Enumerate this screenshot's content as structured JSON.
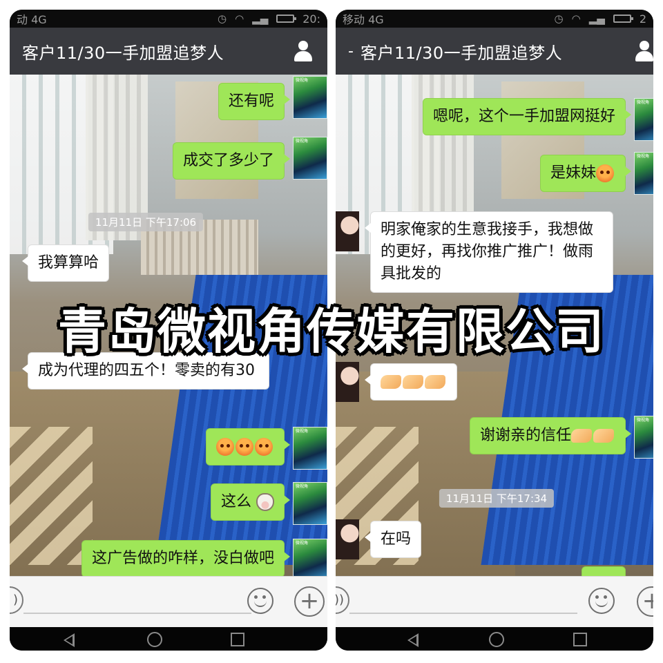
{
  "colors": {
    "titlebar_bg": "#393a3f",
    "sent_bubble": "#9fe658",
    "received_bubble": "#ffffff",
    "statusbar_bg": "#0c0c0c",
    "input_bg": "#f5f5f5"
  },
  "left_phone": {
    "status": {
      "carrier": "动 4G",
      "time": "20:"
    },
    "title": "客户11/30一手加盟追梦人",
    "messages": [
      {
        "side": "sent",
        "text": "还有呢"
      },
      {
        "side": "sent",
        "text": "成交了多少了"
      },
      {
        "side": "timestamp",
        "text": "11月11日 下午17:06"
      },
      {
        "side": "received",
        "text": "我算算哈"
      },
      {
        "side": "received",
        "text": "成为代理的四五个！零卖的有30"
      },
      {
        "side": "sent",
        "emoji": [
          "angry-face-emoji",
          "angry-face-emoji",
          "angry-face-emoji"
        ]
      },
      {
        "side": "sent",
        "text": "这么",
        "emoji": [
          "cow-face-emoji"
        ]
      },
      {
        "side": "sent",
        "text": "这广告做的咋样，没白做吧"
      }
    ]
  },
  "right_phone": {
    "status": {
      "carrier": "移动 4G",
      "time": "2"
    },
    "back_mark": "-",
    "title": "客户11/30一手加盟追梦人",
    "messages": [
      {
        "side": "sent",
        "text": "嗯呢，这个一手加盟网挺好"
      },
      {
        "side": "sent",
        "text": "是妹妹",
        "emoji": [
          "blushing-face-emoji"
        ]
      },
      {
        "side": "received",
        "text": "明家俺家的生意我接手，我想做的更好，再找你推广推广！做雨具批发的"
      },
      {
        "side": "received",
        "emoji": [
          "handshake-emoji",
          "handshake-emoji",
          "handshake-emoji"
        ]
      },
      {
        "side": "sent",
        "text": "谢谢亲的信任",
        "emoji": [
          "handshake-emoji",
          "handshake-emoji"
        ]
      },
      {
        "side": "timestamp",
        "text": "11月11日 下午17:34"
      },
      {
        "side": "received",
        "text": "在吗"
      }
    ]
  },
  "avatar_self_text": "微视角",
  "watermark": "青岛微视角传媒有限公司"
}
